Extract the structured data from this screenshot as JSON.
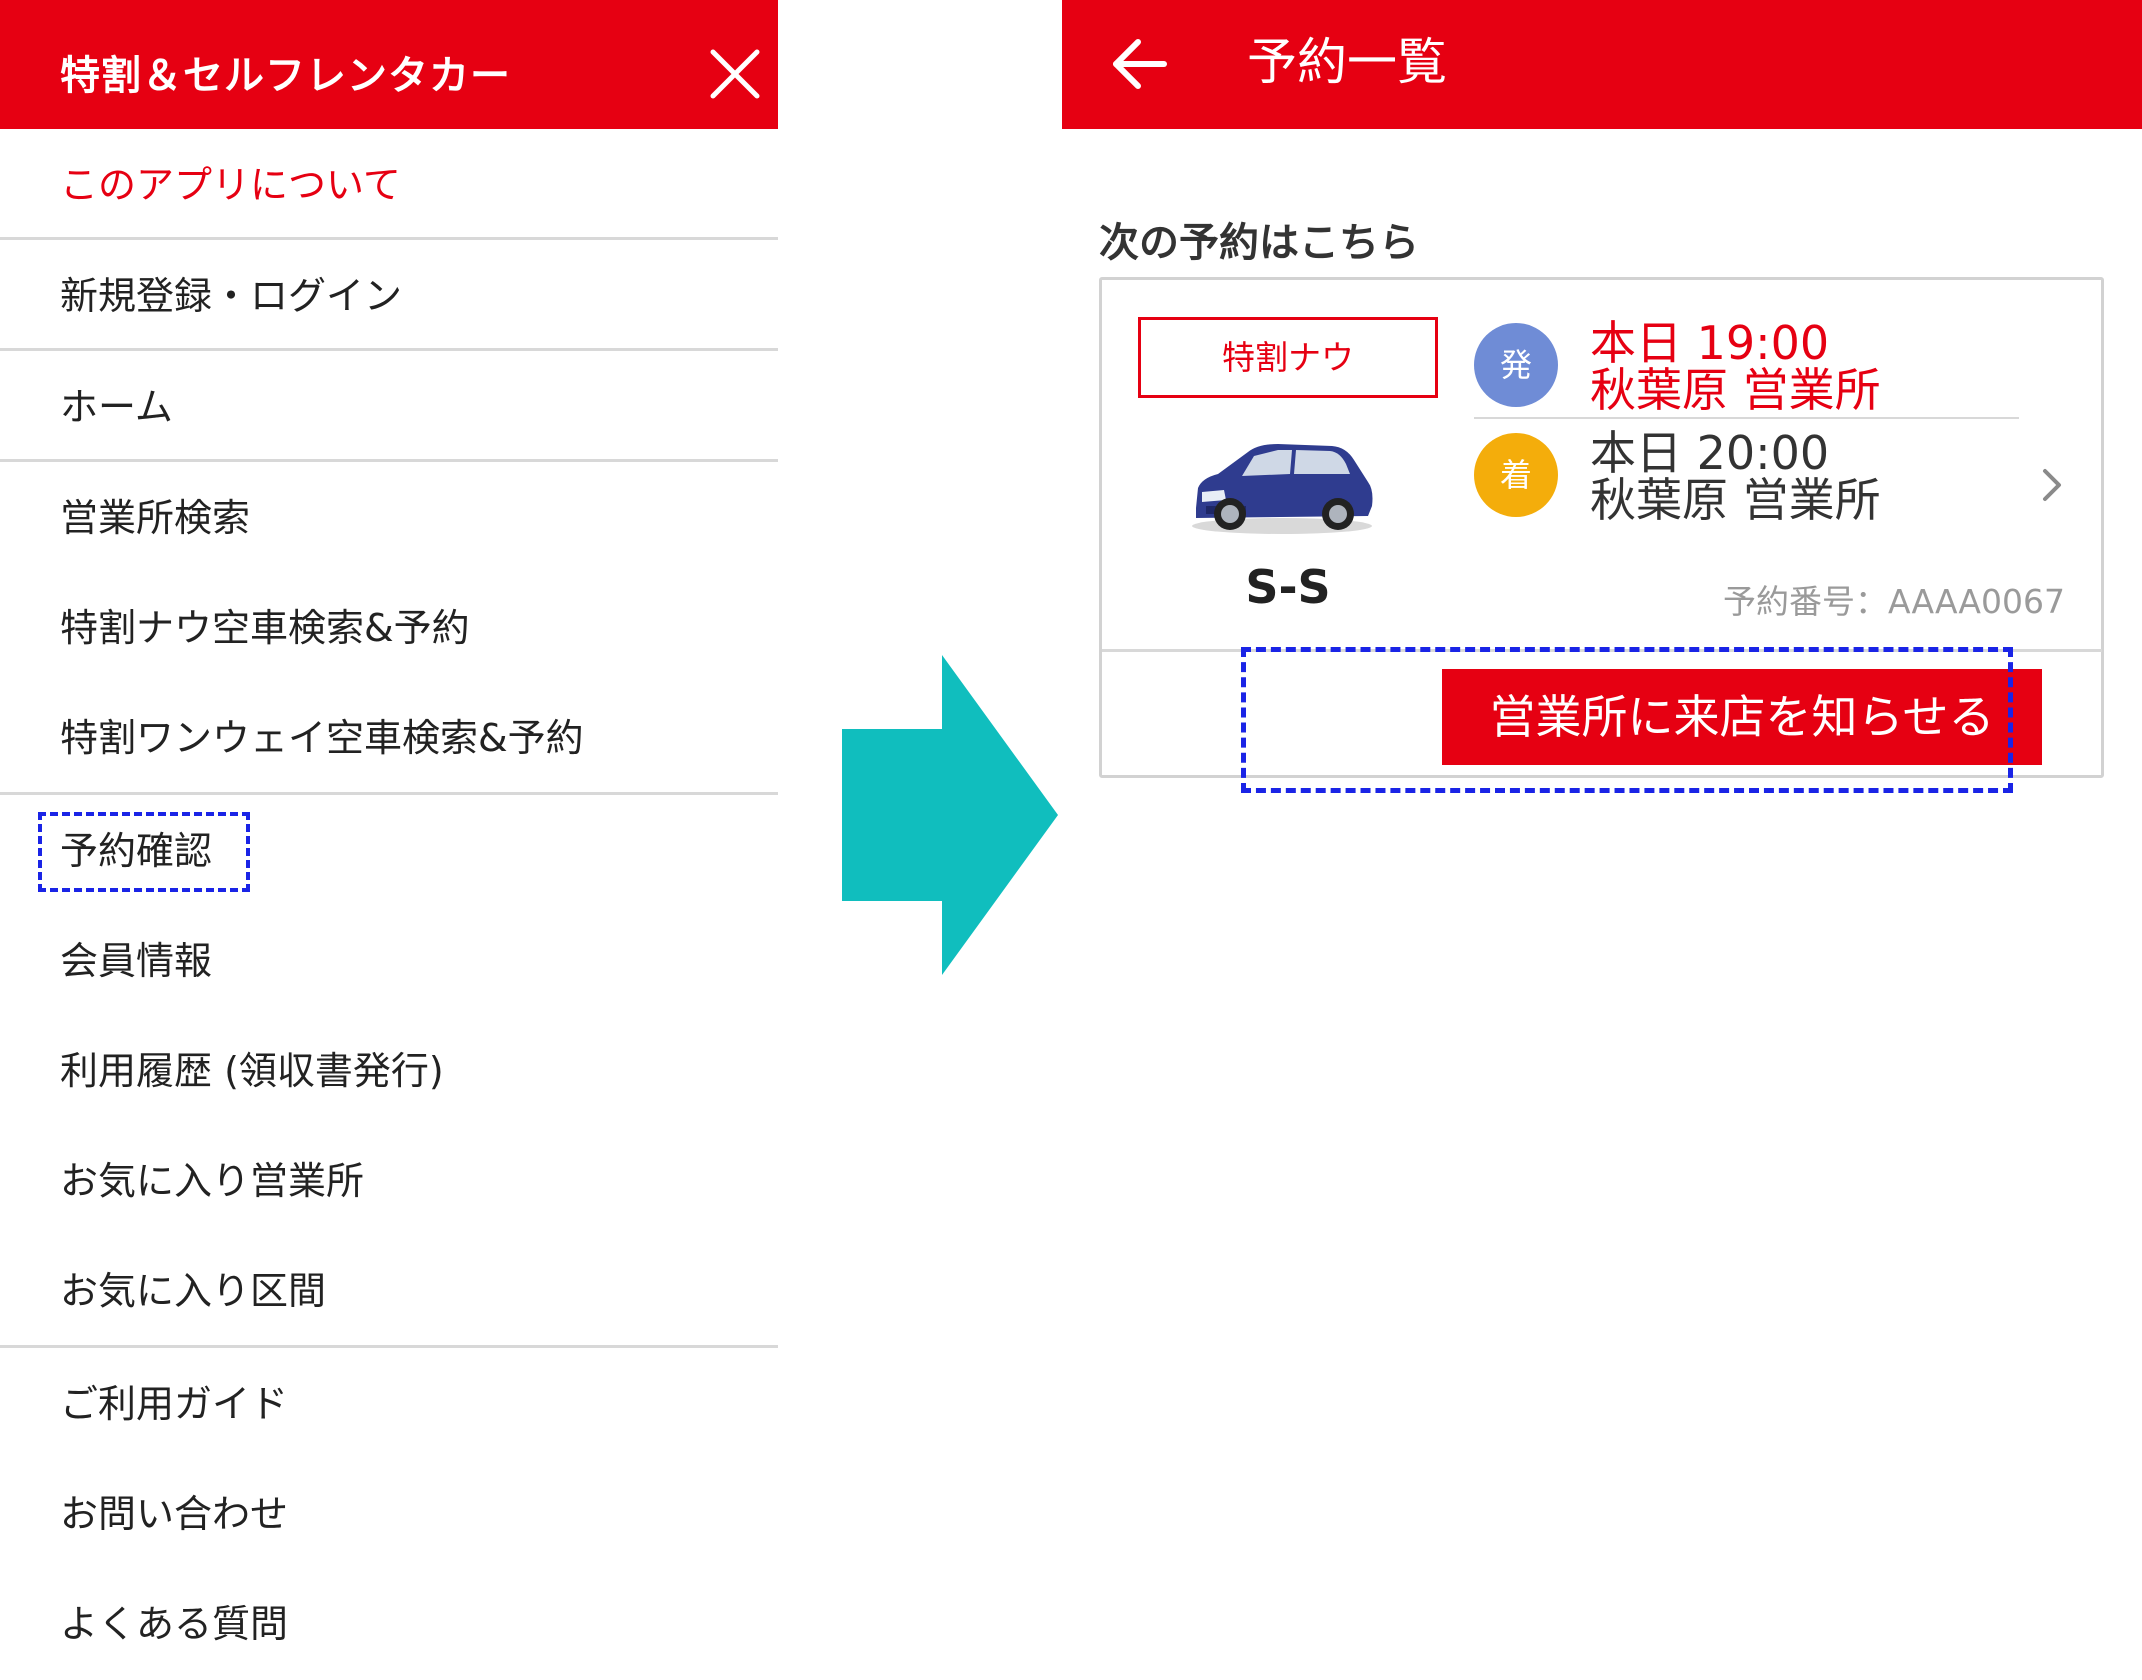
{
  "drawer": {
    "title": "特割＆セルフレンタカー",
    "close_icon": "close-icon",
    "menu": [
      {
        "label": "このアプリについて",
        "highlight_color": true
      },
      {
        "label": "新規登録・ログイン"
      },
      {
        "label": "ホーム"
      },
      {
        "label": "営業所検索"
      },
      {
        "label": "特割ナウ空車検索&予約"
      },
      {
        "label": "特割ワンウェイ空車検索&予約"
      },
      {
        "label": "予約確認",
        "highlighted": true
      },
      {
        "label": "会員情報"
      },
      {
        "label": "利用履歴 (領収書発行)"
      },
      {
        "label": "お気に入り営業所"
      },
      {
        "label": "お気に入り区間"
      },
      {
        "label": "ご利用ガイド"
      },
      {
        "label": "お問い合わせ"
      },
      {
        "label": "よくある質問"
      }
    ]
  },
  "transition": {
    "icon": "arrow-right-icon",
    "color": "#10bebe"
  },
  "screen": {
    "title": "予約一覧",
    "back_icon": "back-arrow-icon",
    "section_title": "次の予約はこちら",
    "reservation": {
      "plan": "特割ナウ",
      "car_class": "S-S",
      "car_icon": "car-image",
      "departure": {
        "badge": "発",
        "datetime": "本日  19:00",
        "office": "秋葉原  営業所"
      },
      "arrival": {
        "badge": "着",
        "datetime": "本日  20:00",
        "office": "秋葉原  営業所"
      },
      "booking_number": "予約番号：AAAA0067",
      "notify_button": "営業所に来店を知らせる"
    }
  },
  "colors": {
    "brand_red": "#e60012",
    "departure_badge": "#6f8cd6",
    "arrival_badge": "#f4ad0b",
    "highlight_dash": "#1a24e6"
  }
}
